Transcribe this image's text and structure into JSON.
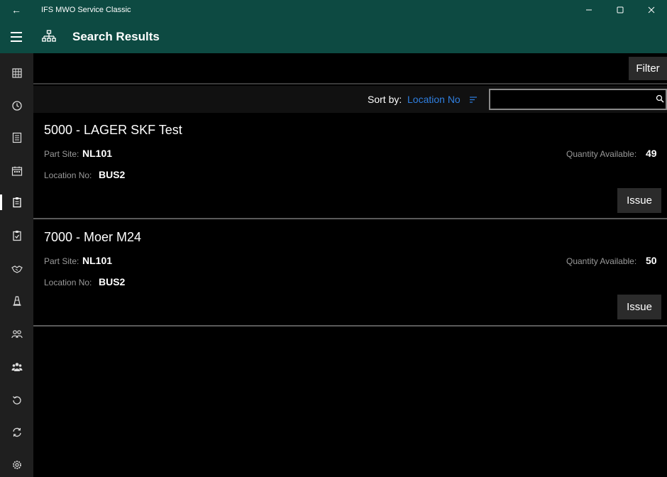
{
  "window": {
    "title": "IFS MWO Service Classic",
    "back_glyph": "←",
    "minimize_glyph": "—",
    "maximize_glyph": "☐",
    "close_glyph": "✕"
  },
  "header": {
    "title": "Search Results",
    "icon": "hierarchy-icon"
  },
  "nav_rail": {
    "items": [
      {
        "icon": "grid-icon"
      },
      {
        "icon": "clock-icon"
      },
      {
        "icon": "list-icon"
      },
      {
        "icon": "calendar-icon"
      },
      {
        "icon": "clipboard-icon",
        "active": true
      },
      {
        "icon": "clipboard-check-icon"
      },
      {
        "icon": "handshake-icon"
      },
      {
        "icon": "traffic-cone-icon"
      },
      {
        "icon": "group-icon"
      },
      {
        "icon": "people-icon"
      },
      {
        "icon": "history-icon"
      },
      {
        "icon": "sync-icon"
      },
      {
        "icon": "settings-icon"
      }
    ]
  },
  "toolbar": {
    "filter_label": "Filter"
  },
  "sort": {
    "label": "Sort by:",
    "value": "Location No",
    "search_value": ""
  },
  "results": [
    {
      "title": "5000 - LAGER SKF Test",
      "part_site_label": "Part Site:",
      "part_site": "NL101",
      "location_label": "Location No:",
      "location": "BUS2",
      "qty_label": "Quantity Available:",
      "qty": "49",
      "action_label": "Issue"
    },
    {
      "title": "7000 - Moer M24",
      "part_site_label": "Part Site:",
      "part_site": "NL101",
      "location_label": "Location No:",
      "location": "BUS2",
      "qty_label": "Quantity Available:",
      "qty": "50",
      "action_label": "Issue"
    }
  ],
  "colors": {
    "header_bg": "#0d4a42",
    "rail_bg": "#1f1f1f",
    "accent": "#2f7fe0"
  }
}
